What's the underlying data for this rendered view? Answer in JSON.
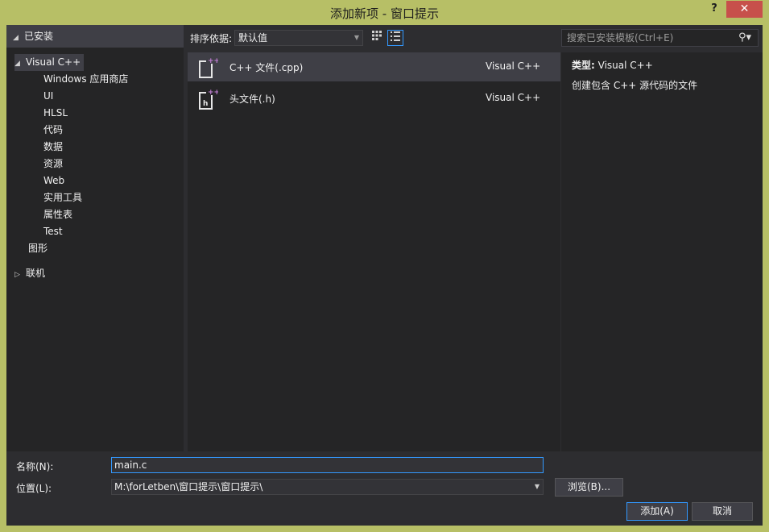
{
  "window": {
    "title": "添加新项 - 窗口提示",
    "help_label": "?",
    "close_label": "✕"
  },
  "tree": {
    "header": "已安装",
    "root": "Visual C++",
    "children": [
      "Windows 应用商店",
      "UI",
      "HLSL",
      "代码",
      "数据",
      "资源",
      "Web",
      "实用工具",
      "属性表",
      "Test"
    ],
    "sibling": "图形",
    "online": "联机"
  },
  "toolbar": {
    "sort_label": "排序依据:",
    "sort_value": "默认值"
  },
  "search": {
    "placeholder": "搜索已安装模板(Ctrl+E)"
  },
  "templates": [
    {
      "name": "C++ 文件(.cpp)",
      "lang": "Visual C++",
      "selected": true,
      "icon": "cpp-file-icon"
    },
    {
      "name": "头文件(.h)",
      "lang": "Visual C++",
      "selected": false,
      "icon": "header-file-icon"
    }
  ],
  "details": {
    "type_label": "类型:",
    "type_value": "Visual C++",
    "description": "创建包含 C++ 源代码的文件"
  },
  "form": {
    "name_label": "名称(N):",
    "name_value": "main.c",
    "location_label": "位置(L):",
    "location_value": "M:\\forLetben\\窗口提示\\窗口提示\\",
    "browse_label": "浏览(B)...",
    "add_label": "添加(A)",
    "cancel_label": "取消"
  },
  "colors": {
    "frame": "#b7bf66",
    "background": "#2d2d30",
    "panel": "#252526",
    "selection": "#3f3f46",
    "accent": "#3399ff",
    "icon_plus": "#c27fd6"
  }
}
